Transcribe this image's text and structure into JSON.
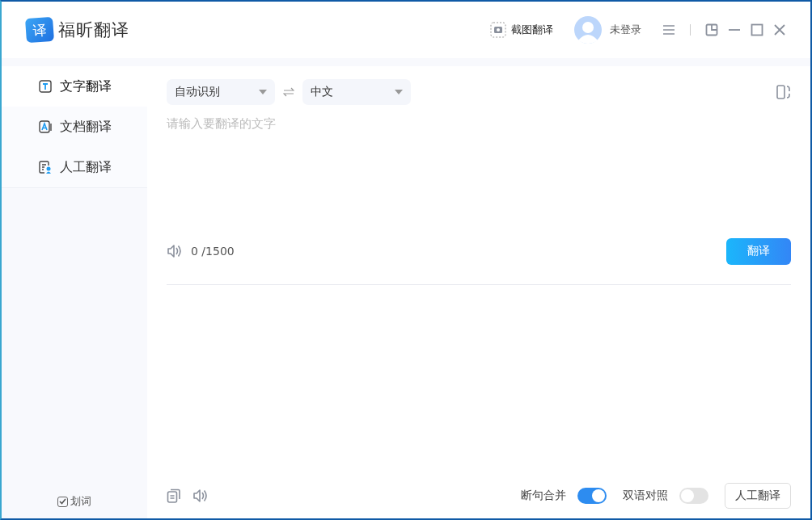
{
  "app": {
    "name": "福昕翻译",
    "logo_glyph": "译"
  },
  "header": {
    "screenshot_button": "截图翻译",
    "user": "未登录"
  },
  "sidebar": {
    "items": [
      {
        "label": "文字翻译",
        "selected": true,
        "kind": "text"
      },
      {
        "label": "文档翻译",
        "selected": false,
        "kind": "document"
      },
      {
        "label": "人工翻译",
        "selected": false,
        "kind": "human"
      }
    ],
    "word_pick": {
      "label": "划词",
      "checked": true
    }
  },
  "translator": {
    "source_lang": "自动识别",
    "target_lang": "中文",
    "input": {
      "placeholder": "请输入要翻译的文字"
    },
    "char_count": "0 /1500",
    "translate_button": "翻译"
  },
  "output_bar": {
    "toggles": [
      {
        "label": "断句合并",
        "on": true
      },
      {
        "label": "双语对照",
        "on": false
      }
    ],
    "human_button": "人工翻译"
  }
}
